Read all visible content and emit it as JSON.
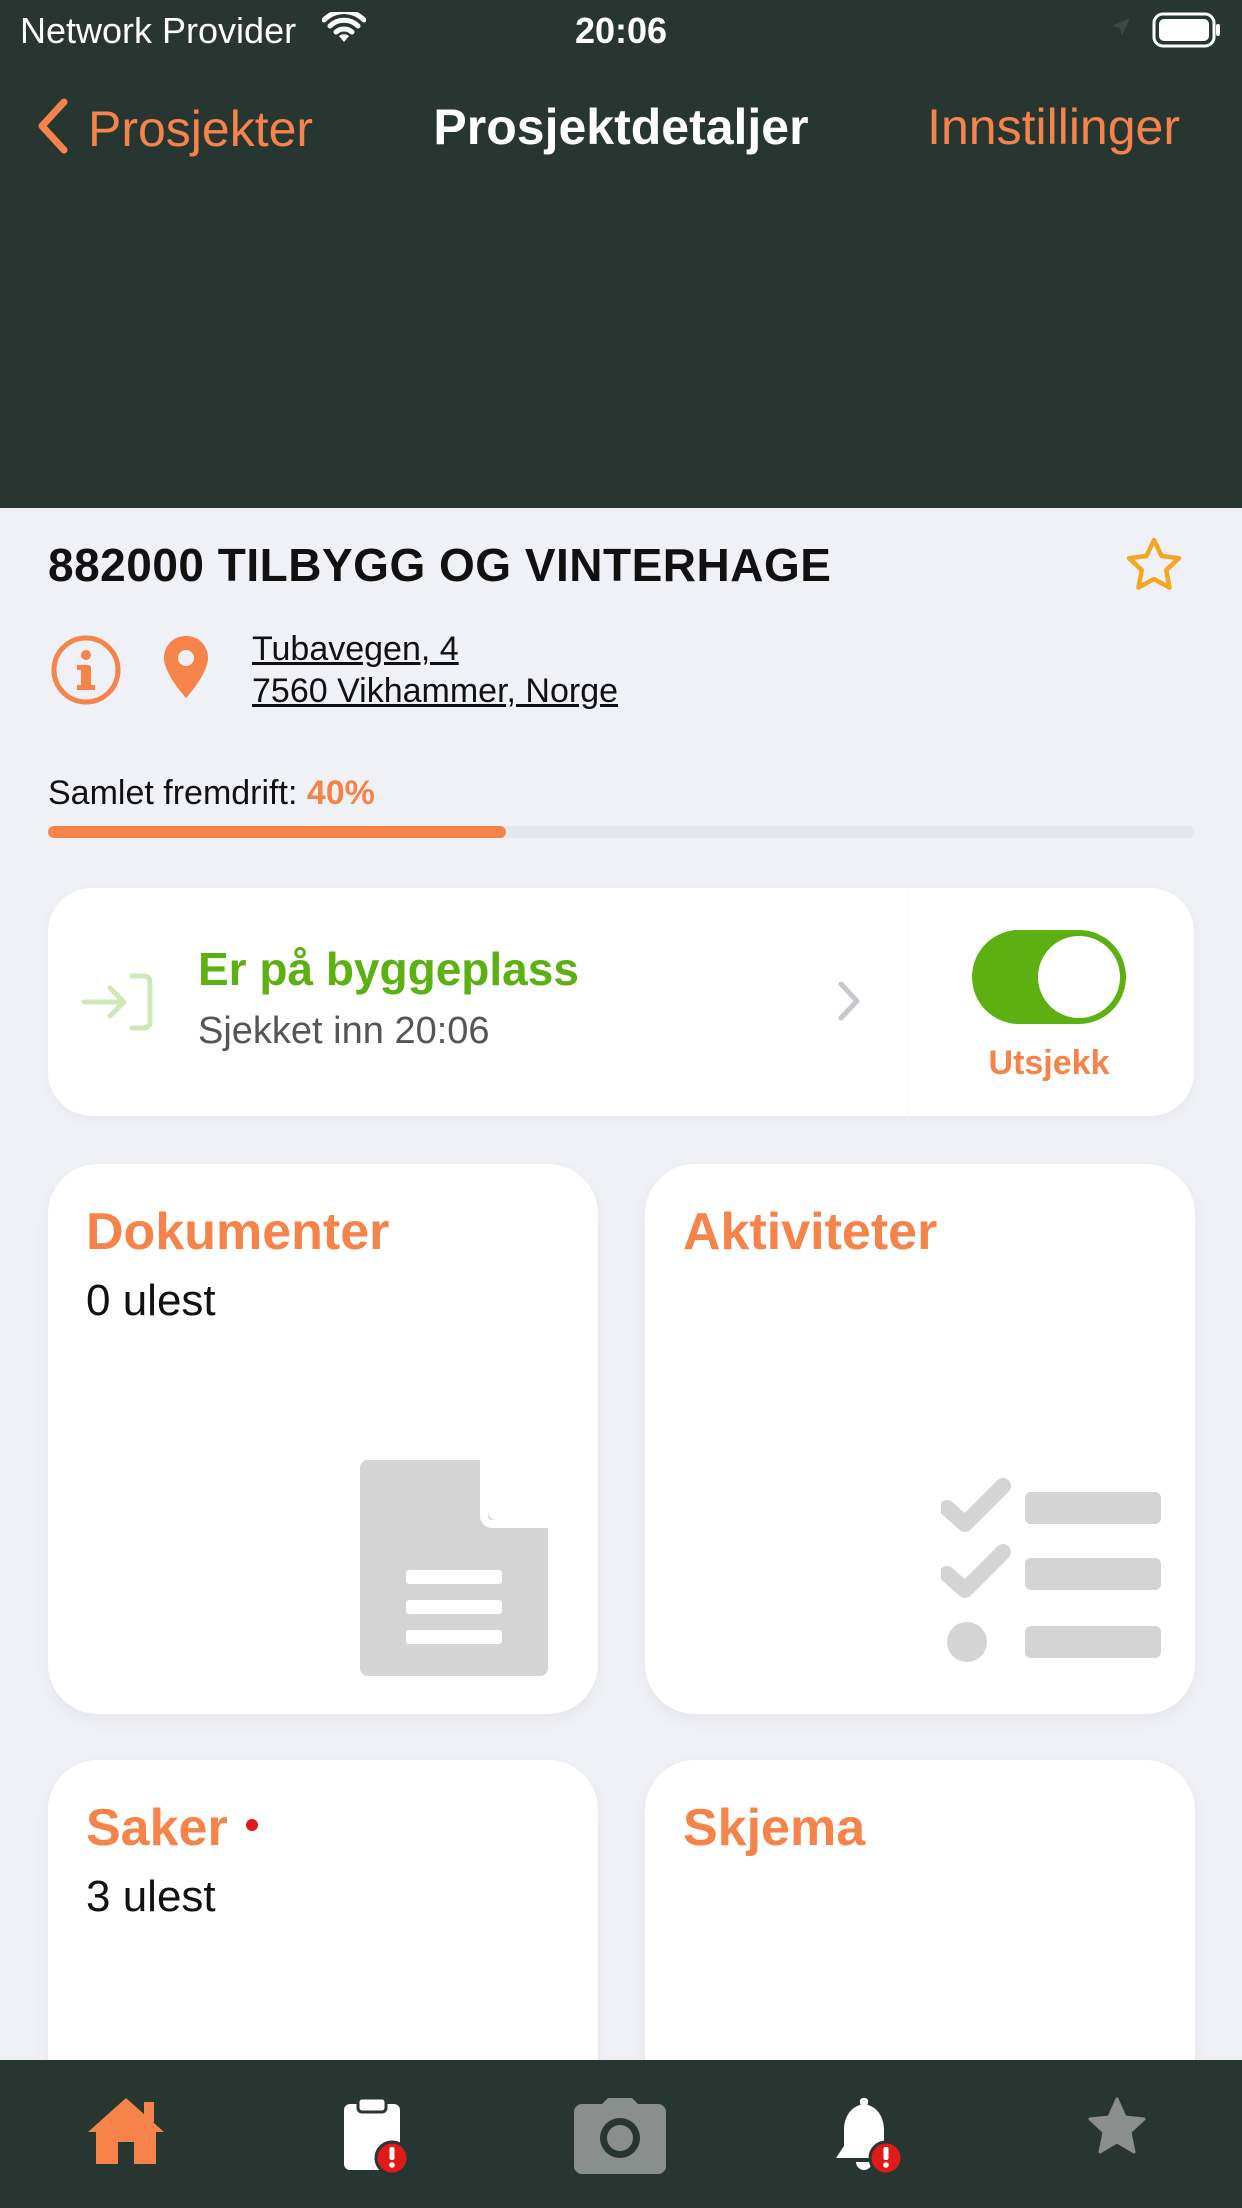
{
  "status_bar": {
    "provider": "Network Provider",
    "time": "20:06"
  },
  "nav": {
    "back_label": "Prosjekter",
    "title": "Prosjektdetaljer",
    "settings_label": "Innstillinger"
  },
  "project": {
    "title": "882000 TILBYGG OG VINTERHAGE",
    "address_line1": "Tubavegen, 4",
    "address_line2": "7560 Vikhammer, Norge",
    "progress_label": "Samlet fremdrift:",
    "progress_text": "40%",
    "progress_fraction": 0.4
  },
  "checkin": {
    "title": "Er på byggeplass",
    "subtitle": "Sjekket inn 20:06",
    "toggle_on": true,
    "toggle_label": "Utsjekk"
  },
  "tiles": {
    "documents": {
      "title": "Dokumenter",
      "subtitle": "0 ulest"
    },
    "activities": {
      "title": "Aktiviteter",
      "subtitle": ""
    },
    "cases": {
      "title": "Saker",
      "subtitle": "3 ulest",
      "unread_dot": true
    },
    "forms": {
      "title": "Skjema",
      "subtitle": ""
    }
  },
  "tabbar": {
    "items": [
      {
        "icon": "home-icon",
        "active": true
      },
      {
        "icon": "clipboard-alert-icon",
        "active": false,
        "badge": "!"
      },
      {
        "icon": "camera-icon",
        "active": false
      },
      {
        "icon": "bell-alert-icon",
        "active": false,
        "badge": "!"
      },
      {
        "icon": "star-icon",
        "active": false
      }
    ]
  },
  "colors": {
    "accent": "#f5834a",
    "dark_bg": "#283631",
    "success": "#5cb012",
    "badge_red": "#e0191b",
    "page_bg": "#f0f1f6"
  }
}
